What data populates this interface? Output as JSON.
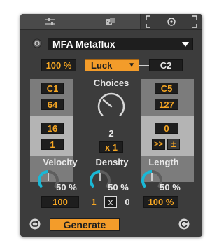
{
  "tabs": [
    {
      "icon": "sliders-icon",
      "selected": false
    },
    {
      "icon": "dice-icon",
      "selected": false
    },
    {
      "icon": "focus-target-icon",
      "selected": true
    }
  ],
  "preset": {
    "name": "MFA Metaflux"
  },
  "top_row": {
    "amount": "100 %",
    "mode": "Luck",
    "mode_arrow": "▼",
    "target_note": "C2"
  },
  "choices": {
    "label": "Choices",
    "value": "2",
    "multiplier": "x 1"
  },
  "left_column": {
    "note": "C1",
    "value": "64",
    "upper": "16",
    "lower": "1"
  },
  "right_column": {
    "note": "C5",
    "value": "127",
    "upper": "0",
    "button_a": ">>",
    "button_b": "±"
  },
  "params": [
    {
      "label": "Velocity",
      "percent": "50 %",
      "value": "100",
      "knob_fraction": 0.5
    },
    {
      "label": "Density",
      "percent": "50 %",
      "value_left": "1",
      "toggle": "x",
      "value_right": "0",
      "knob_fraction": 0.5
    },
    {
      "label": "Length",
      "percent": "50 %",
      "value": "100 %",
      "knob_fraction": 0.5
    }
  ],
  "footer": {
    "generate_label": "Generate"
  },
  "colors": {
    "accent": "#f5a623",
    "knob_arc": "#19b8d6",
    "panel": "#3c3c3c",
    "light_panel": "#b4b4b4",
    "field": "#1e1e1e",
    "generate_bg": "#f39c2a"
  }
}
